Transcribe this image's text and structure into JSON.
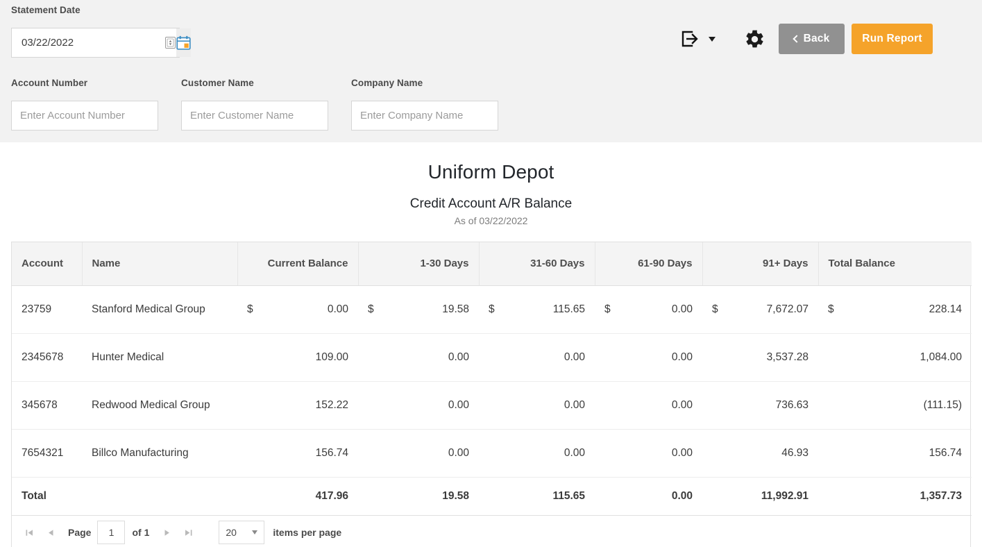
{
  "filters": {
    "statement_date_label": "Statement Date",
    "statement_date_value": "03/22/2022",
    "account_number_label": "Account Number",
    "account_number_placeholder": "Enter Account Number",
    "account_number_value": "",
    "customer_name_label": "Customer Name",
    "customer_name_placeholder": "Enter Customer Name",
    "customer_name_value": "",
    "company_name_label": "Company Name",
    "company_name_placeholder": "Enter Company Name",
    "company_name_value": ""
  },
  "toolbar": {
    "export_icon": "export-icon",
    "export_caret_icon": "chevron-down-icon",
    "settings_icon": "gear-icon",
    "back_label": "Back",
    "back_icon": "chevron-left-icon",
    "back_color": "#919191",
    "run_report_label": "Run Report",
    "run_report_color": "#f5a32a"
  },
  "report": {
    "company": "Uniform Depot",
    "title": "Credit Account A/R Balance",
    "as_of": "As of 03/22/2022"
  },
  "table": {
    "columns": [
      {
        "label": "Account",
        "align": "txt"
      },
      {
        "label": "Name",
        "align": "txt"
      },
      {
        "label": "Current Balance",
        "align": "num"
      },
      {
        "label": "1-30 Days",
        "align": "num"
      },
      {
        "label": "31-60 Days",
        "align": "num"
      },
      {
        "label": "61-90 Days",
        "align": "num"
      },
      {
        "label": "91+ Days",
        "align": "num"
      },
      {
        "label": "Total Balance",
        "align": "txt"
      }
    ],
    "currency_symbol": "$",
    "rows": [
      {
        "account": "23759",
        "name": "Stanford Medical Group",
        "current_balance": "0.00",
        "days_1_30": "19.58",
        "days_31_60": "115.65",
        "days_61_90": "0.00",
        "days_91_plus": "7,672.07",
        "total_balance": "228.14",
        "show_currency": true
      },
      {
        "account": "2345678",
        "name": "Hunter Medical",
        "current_balance": "109.00",
        "days_1_30": "0.00",
        "days_31_60": "0.00",
        "days_61_90": "0.00",
        "days_91_plus": "3,537.28",
        "total_balance": "1,084.00",
        "show_currency": false
      },
      {
        "account": "345678",
        "name": "Redwood Medical Group",
        "current_balance": "152.22",
        "days_1_30": "0.00",
        "days_31_60": "0.00",
        "days_61_90": "0.00",
        "days_91_plus": "736.63",
        "total_balance": "(111.15)",
        "show_currency": false
      },
      {
        "account": "7654321",
        "name": "Billco Manufacturing",
        "current_balance": "156.74",
        "days_1_30": "0.00",
        "days_31_60": "0.00",
        "days_61_90": "0.00",
        "days_91_plus": "46.93",
        "total_balance": "156.74",
        "show_currency": false
      }
    ],
    "total_row": {
      "label": "Total",
      "current_balance": "417.96",
      "days_1_30": "19.58",
      "days_31_60": "115.65",
      "days_61_90": "0.00",
      "days_91_plus": "11,992.91",
      "total_balance": "1,357.73"
    }
  },
  "pager": {
    "first_icon": "page-first-icon",
    "prev_icon": "page-prev-icon",
    "page_label": "Page",
    "page_value": "1",
    "of_label": "of 1",
    "next_icon": "page-next-icon",
    "last_icon": "page-last-icon",
    "page_size": "20",
    "page_size_caret_icon": "chevron-down-icon",
    "items_per_page_label": "items per page"
  }
}
